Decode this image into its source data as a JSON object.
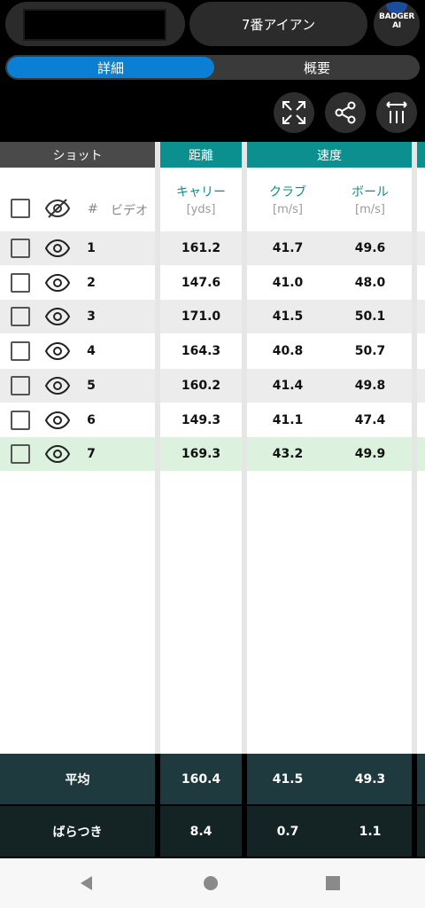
{
  "header": {
    "club": "7番アイアン",
    "logo_text": "BADGER AI"
  },
  "tabs": {
    "active": "詳細",
    "inactive": "概要"
  },
  "actions": [
    {
      "name": "expand-icon"
    },
    {
      "name": "share-icon"
    },
    {
      "name": "column-width-icon"
    }
  ],
  "table": {
    "group_headers": {
      "shot": "ショット",
      "distance": "距離",
      "speed": "速度"
    },
    "columns": {
      "hash": "#",
      "video": "ビデオ",
      "carry": {
        "label": "キャリー",
        "unit": "[yds]"
      },
      "club_speed": {
        "label": "クラブ",
        "unit": "[m/s]"
      },
      "ball_speed": {
        "label": "ボール",
        "unit": "[m/s]"
      }
    },
    "rows": [
      {
        "no": "1",
        "carry": "161.2",
        "club": "41.7",
        "ball": "49.6"
      },
      {
        "no": "2",
        "carry": "147.6",
        "club": "41.0",
        "ball": "48.0"
      },
      {
        "no": "3",
        "carry": "171.0",
        "club": "41.5",
        "ball": "50.1"
      },
      {
        "no": "4",
        "carry": "164.3",
        "club": "40.8",
        "ball": "50.7"
      },
      {
        "no": "5",
        "carry": "160.2",
        "club": "41.4",
        "ball": "49.8"
      },
      {
        "no": "6",
        "carry": "149.3",
        "club": "41.1",
        "ball": "47.4"
      },
      {
        "no": "7",
        "carry": "169.3",
        "club": "43.2",
        "ball": "49.9"
      }
    ]
  },
  "stats": {
    "average": {
      "label": "平均",
      "carry": "160.4",
      "club": "41.5",
      "ball": "49.3"
    },
    "variation": {
      "label": "ばらつき",
      "carry": "8.4",
      "club": "0.7",
      "ball": "1.1"
    }
  },
  "colors": {
    "accent": "#0a7fd4",
    "teal": "#0b8f8f",
    "selected_row": "#dcf1de"
  }
}
